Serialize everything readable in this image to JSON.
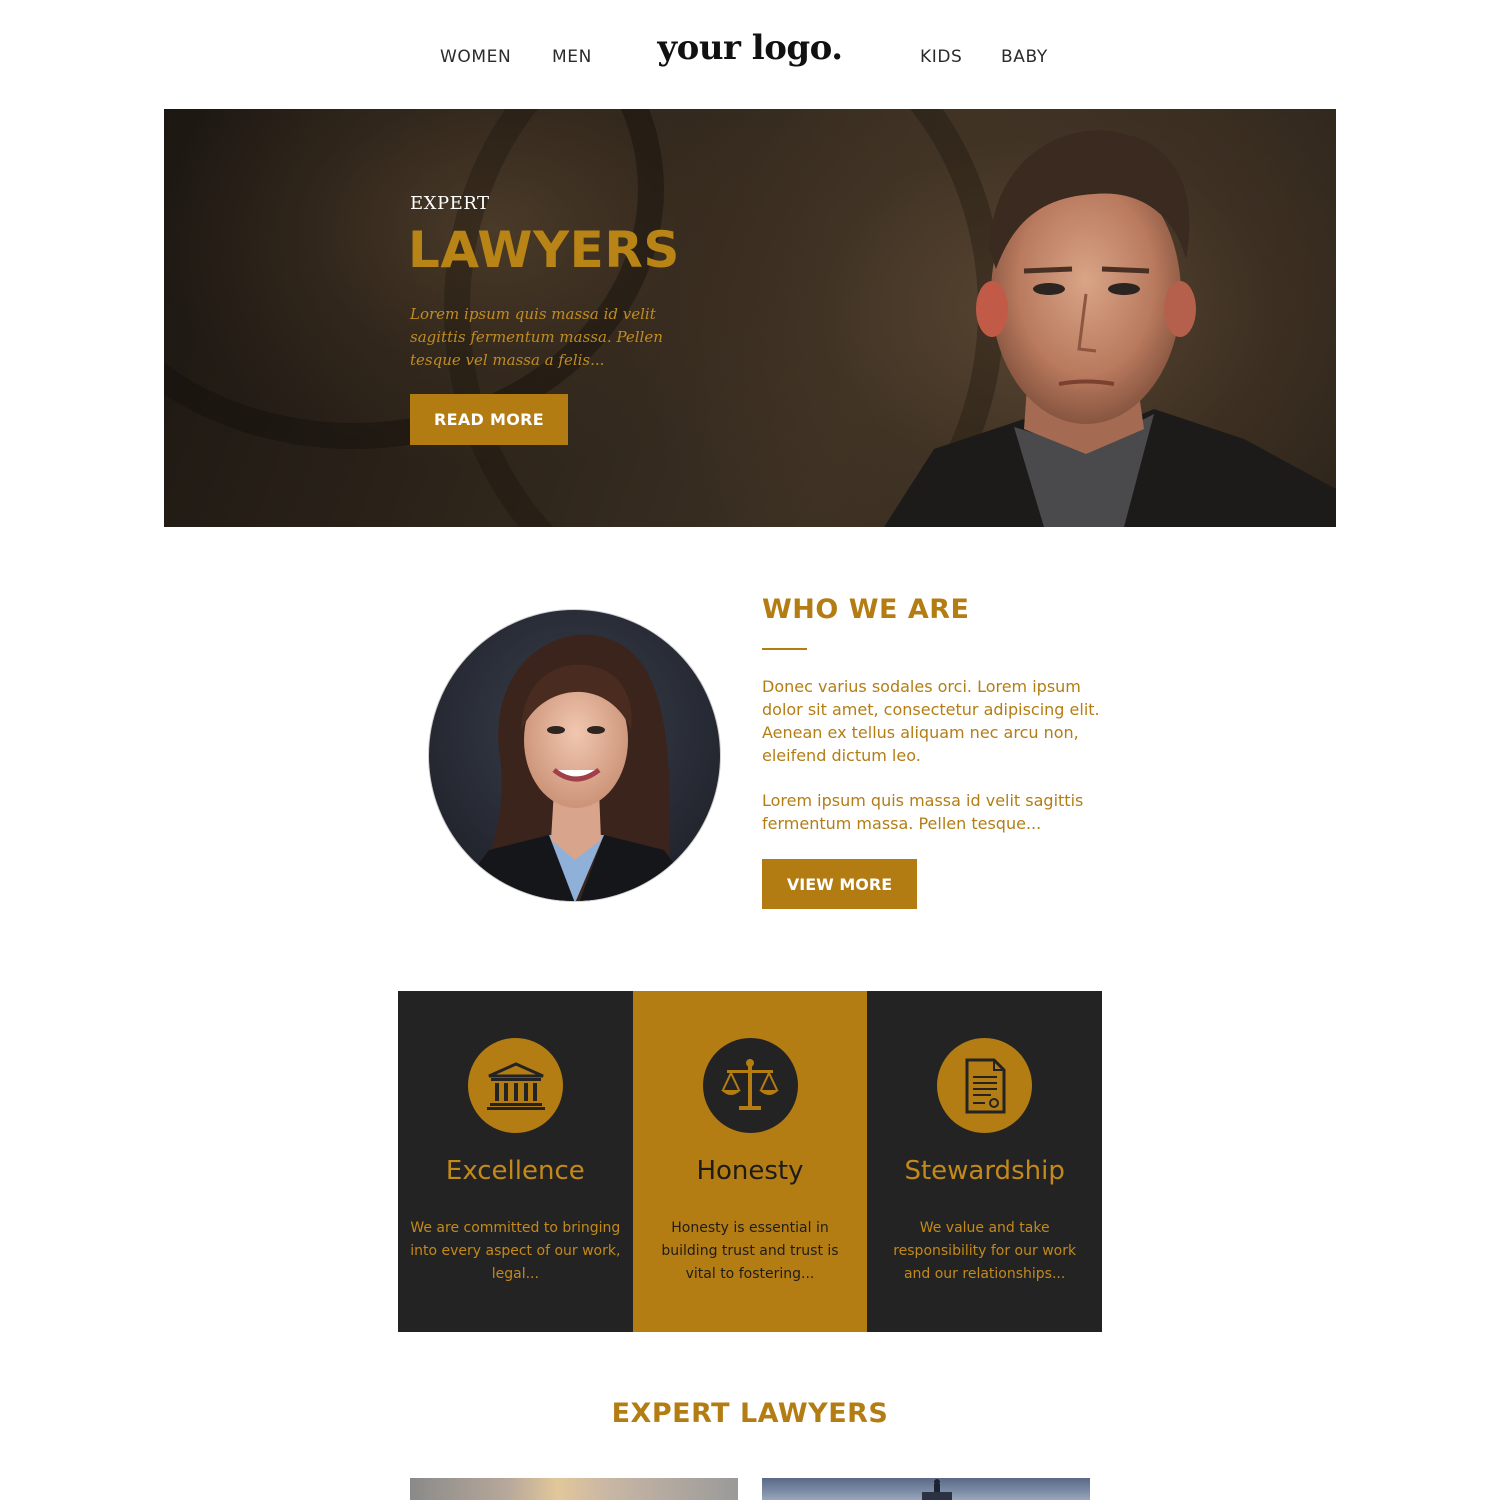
{
  "nav": {
    "left_items": [
      "WOMEN",
      "MEN"
    ],
    "right_items": [
      "KIDS",
      "BABY"
    ],
    "logo": "your logo."
  },
  "hero": {
    "eyebrow": "EXPERT",
    "title": "LAWYERS",
    "text": "Lorem ipsum quis massa id velit sagittis fermentum massa. Pellen tesque vel massa a felis...",
    "button": "READ MORE"
  },
  "who": {
    "title": "WHO WE ARE",
    "p1": "Donec varius sodales orci. Lorem ipsum dolor sit amet, consectetur adipiscing elit. Aenean ex tellus aliquam nec arcu non, eleifend dictum leo.",
    "p2": "Lorem ipsum quis massa id velit sagittis fermentum massa. Pellen tesque...",
    "button": "VIEW MORE"
  },
  "values": [
    {
      "title": "Excellence",
      "text": "We are committed to bringing into every aspect of our work, legal...",
      "icon": "courthouse-icon"
    },
    {
      "title": "Honesty",
      "text": "Honesty is essential in building trust and trust is vital to fostering...",
      "icon": "scales-icon"
    },
    {
      "title": "Stewardship",
      "text": "We value and take responsibility for our work and our relationships...",
      "icon": "document-icon"
    }
  ],
  "experts": {
    "title": "EXPERT LAWYERS"
  },
  "colors": {
    "gold": "#b47d14",
    "dark": "#242323"
  }
}
